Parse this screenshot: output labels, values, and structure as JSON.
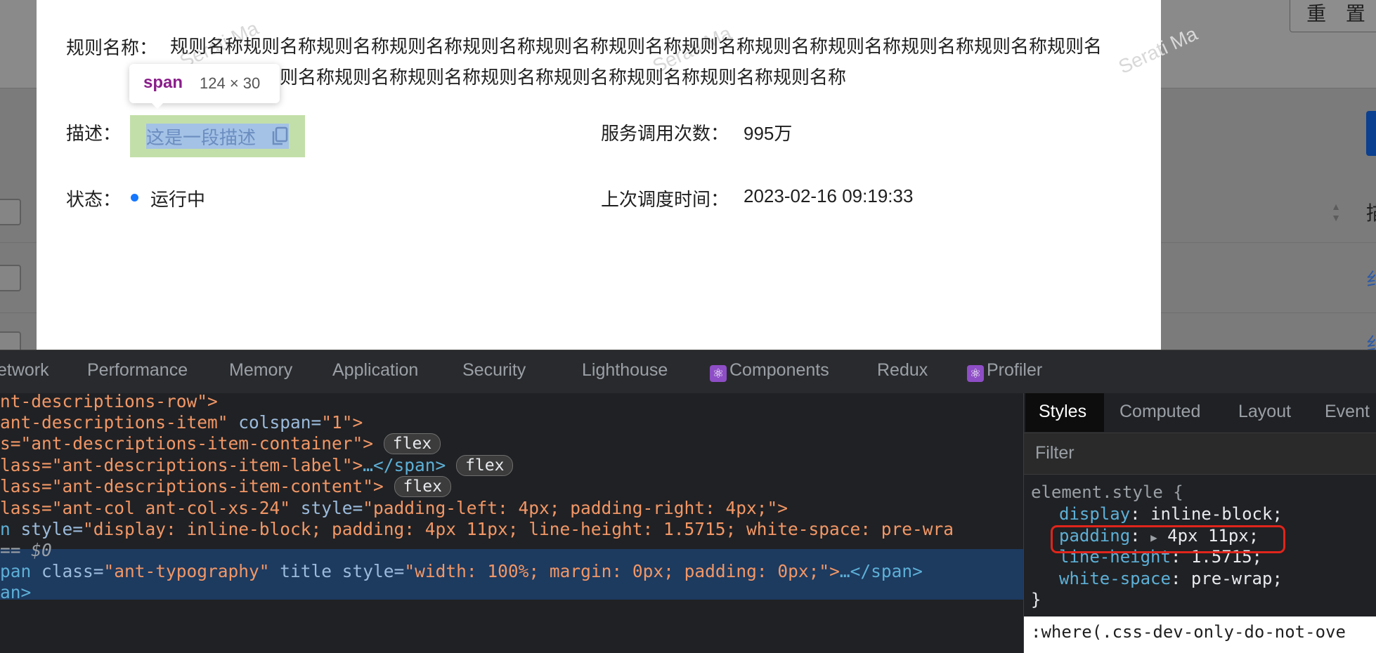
{
  "background_page": {
    "reset_button": "重 置",
    "col_char": "描",
    "link_char": "纟"
  },
  "modal": {
    "rule_name_label": "规则名称：",
    "rule_name_value": "规则名称规则名称规则名称规则名称规则名称规则名称规则名称规则名称规则名称规则名称规则名称规则名称规则名称规则名称规则名称规则名称规则名称规则名称规则名称规则名称规则名称规则名称",
    "desc_label": "描述：",
    "desc_value": "这是一段描述",
    "calls_label": "服务调用次数：",
    "calls_value": "995万",
    "status_label": "状态：",
    "status_value": "运行中",
    "last_run_label": "上次调度时间：",
    "last_run_value": "2023-02-16 09:19:33",
    "watermark": "Serati Ma",
    "tooltip": {
      "tag": "span",
      "size": "124 × 30"
    }
  },
  "devtools": {
    "tabs": [
      "etwork",
      "Performance",
      "Memory",
      "Application",
      "Security",
      "Lighthouse",
      "Components",
      "Redux",
      "Profiler"
    ],
    "code": {
      "l1": "nt-descriptions-row\">",
      "l2_name": "ant-descriptions-item\"",
      "l2_attr": " colspan=",
      "l2_val": "\"1\">",
      "l3_name": "s=\"ant-descriptions-item-container\">",
      "l4_name": "lass=\"ant-descriptions-item-label\">",
      "l4_rest": "…</span>",
      "l5_name": "lass=\"ant-descriptions-item-content\">",
      "l6_name": "lass=\"ant-col ant-col-xs-24\"",
      "l6_attr": " style=",
      "l6_val": "\"padding-left: 4px; padding-right: 4px;\">",
      "l7_tag": "n",
      "l7_attr": " style=",
      "l7_val": "\"display: inline-block; padding: 4px 11px; line-height: 1.5715; white-space: pre-wra",
      "l8": "== $0",
      "l9_tag": "pan",
      "l9_attr1": " class=",
      "l9_val1": "\"ant-typography\"",
      "l9_attr2": " title style=",
      "l9_val2": "\"width: 100%; margin: 0px; padding: 0px;\">",
      "l9_rest": "…</span>",
      "l10": "an>",
      "badge": "flex"
    },
    "styles": {
      "tabs": [
        "Styles",
        "Computed",
        "Layout",
        "Event"
      ],
      "filter": "Filter",
      "selector": "element.style {",
      "rules": [
        {
          "prop": "display",
          "value": "inline-block;"
        },
        {
          "prop": "padding",
          "value": "4px 11px;"
        },
        {
          "prop": "line-height",
          "value": "1.5715;"
        },
        {
          "prop": "white-space",
          "value": "pre-wrap;"
        }
      ],
      "close": "}",
      "next_selector": ":where(.css-dev-only-do-not-ove"
    }
  }
}
